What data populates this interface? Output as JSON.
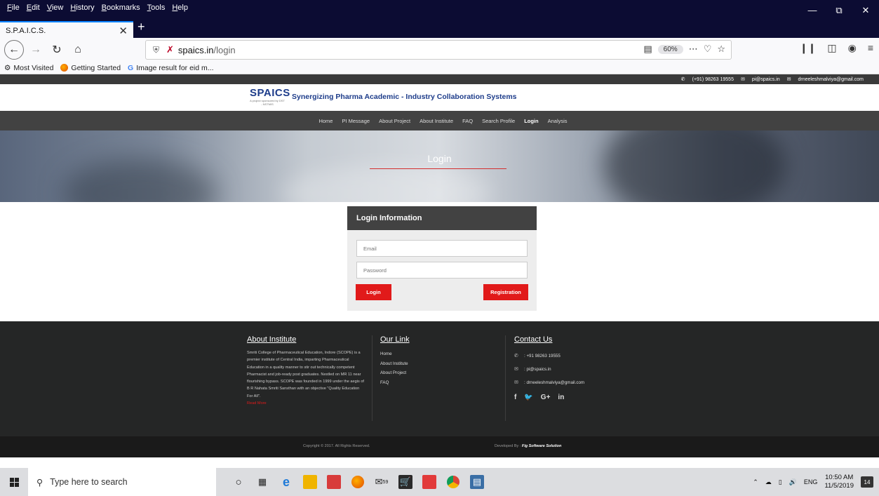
{
  "browser": {
    "menu": [
      "File",
      "Edit",
      "View",
      "History",
      "Bookmarks",
      "Tools",
      "Help"
    ],
    "tab_title": "S.P.A.I.C.S.",
    "url_host": "spaics.in",
    "url_path": "/login",
    "zoom": "60%",
    "bookmarks": [
      "Most Visited",
      "Getting Started",
      "Image result for eid m..."
    ]
  },
  "site": {
    "contact_strip": [
      "(+91) 98263 19555",
      "pi@spaics.in",
      "drneeleshmalviya@gmail.com"
    ],
    "logo_text": "SPAICS",
    "logo_sub": "A project sponsored by DST - NSTMIS",
    "tagline": "Synergizing Pharma Academic - Industry Collaboration Systems",
    "nav": [
      "Home",
      "PI Message",
      "About Project",
      "About Institute",
      "FAQ",
      "Search Profile",
      "Login",
      "Analysis"
    ],
    "active_nav": "Login",
    "hero_title": "Login",
    "accent_color": "#e11a1a"
  },
  "login": {
    "heading": "Login Information",
    "email_placeholder": "Email",
    "password_placeholder": "Password",
    "login_label": "Login",
    "register_label": "Registration"
  },
  "footer": {
    "about_heading": "About Institute",
    "about_text": "Smriti College of Pharmaceutical Education, Indore (SCOPE) is a premier institute of Central India, imparting Pharmaceutical Education in a quality manner to stir out technically competent Pharmacist and job-ready post graduates. Nestled on MR 11 near flourishing bypass. SCOPE was founded in 1999 under the aegis of B R Nahata Smriti Sansthan with an objective \"Quality Education For All\".",
    "read_more": "Read More",
    "links_heading": "Our Link",
    "links": [
      "Home",
      "About Institute",
      "About Project",
      "FAQ"
    ],
    "contact_heading": "Contact Us",
    "phone": ": +91 98263 19555",
    "email1": ": pi@spaics.in",
    "email2": ": drneeleshmalviya@gmail.com",
    "social": [
      "f",
      "G+",
      "in"
    ],
    "copyright": "Copyright © 2017. All Rights Reserved.",
    "developed_by": "Developed By :",
    "developer": "Fig Software Solution"
  },
  "taskbar": {
    "search_placeholder": "Type here to search",
    "mail_badge": "59",
    "language": "ENG",
    "time": "10:50 AM",
    "date": "11/5/2019",
    "notifications": "14"
  }
}
